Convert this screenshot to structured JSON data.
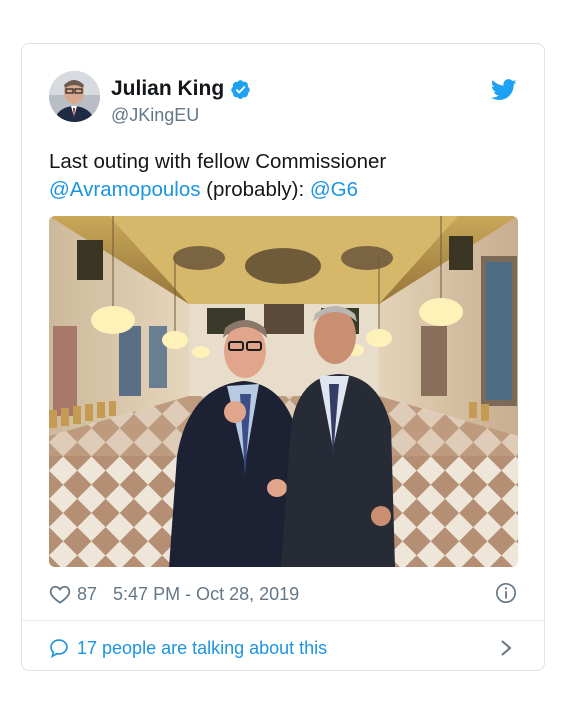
{
  "tweet": {
    "author_name": "Julian King",
    "author_handle": "@JKingEU",
    "text_part1": "Last outing with fellow Commissioner",
    "mention1": "@Avramopoulos",
    "text_part2": " (probably): ",
    "mention2": "@G6",
    "likes": "87",
    "timestamp": "5:47 PM - Oct 28, 2019",
    "conversation_label": "17 people are talking about this"
  },
  "colors": {
    "brand": "#1da1f2",
    "link": "#1b95e0",
    "secondary_text": "#657786"
  },
  "icons": [
    "verified-badge-icon",
    "twitter-bird-icon",
    "heart-icon",
    "info-icon",
    "speech-bubble-icon",
    "chevron-right-icon"
  ]
}
